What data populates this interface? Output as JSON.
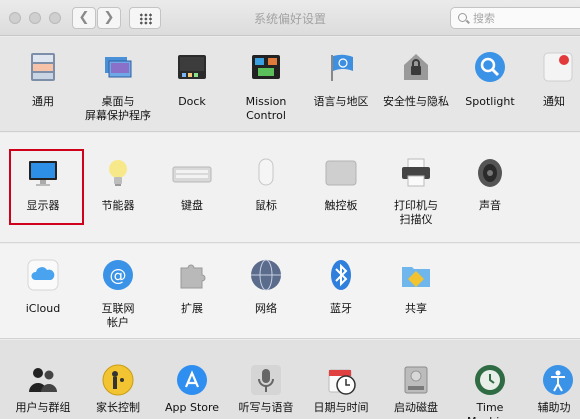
{
  "window": {
    "title": "系统偏好设置"
  },
  "search": {
    "placeholder": "搜索"
  },
  "rows": [
    {
      "items": [
        {
          "label": "通用",
          "icon": "general-icon"
        },
        {
          "label": "桌面与\n屏幕保护程序",
          "icon": "desktop-icon"
        },
        {
          "label": "Dock",
          "icon": "dock-icon"
        },
        {
          "label": "Mission\nControl",
          "icon": "mission-control-icon"
        },
        {
          "label": "语言与地区",
          "icon": "language-region-icon"
        },
        {
          "label": "安全性与隐私",
          "icon": "security-icon"
        },
        {
          "label": "Spotlight",
          "icon": "spotlight-icon"
        },
        {
          "label": "通知",
          "icon": "notifications-icon"
        }
      ]
    },
    {
      "items": [
        {
          "label": "显示器",
          "icon": "display-icon"
        },
        {
          "label": "节能器",
          "icon": "energy-saver-icon"
        },
        {
          "label": "键盘",
          "icon": "keyboard-icon"
        },
        {
          "label": "鼠标",
          "icon": "mouse-icon"
        },
        {
          "label": "触控板",
          "icon": "trackpad-icon"
        },
        {
          "label": "打印机与\n扫描仪",
          "icon": "printer-icon"
        },
        {
          "label": "声音",
          "icon": "sound-icon"
        }
      ]
    },
    {
      "items": [
        {
          "label": "iCloud",
          "icon": "icloud-icon"
        },
        {
          "label": "互联网\n帐户",
          "icon": "internet-accounts-icon"
        },
        {
          "label": "扩展",
          "icon": "extensions-icon"
        },
        {
          "label": "网络",
          "icon": "network-icon"
        },
        {
          "label": "蓝牙",
          "icon": "bluetooth-icon"
        },
        {
          "label": "共享",
          "icon": "sharing-icon"
        }
      ]
    },
    {
      "items": [
        {
          "label": "用户与群组",
          "icon": "users-groups-icon"
        },
        {
          "label": "家长控制",
          "icon": "parental-controls-icon"
        },
        {
          "label": "App Store",
          "icon": "app-store-icon"
        },
        {
          "label": "听写与语音",
          "icon": "dictation-icon"
        },
        {
          "label": "日期与时间",
          "icon": "date-time-icon"
        },
        {
          "label": "启动磁盘",
          "icon": "startup-disk-icon"
        },
        {
          "label": "Time Machine",
          "icon": "time-machine-icon"
        },
        {
          "label": "辅助功",
          "icon": "accessibility-icon"
        }
      ]
    }
  ]
}
